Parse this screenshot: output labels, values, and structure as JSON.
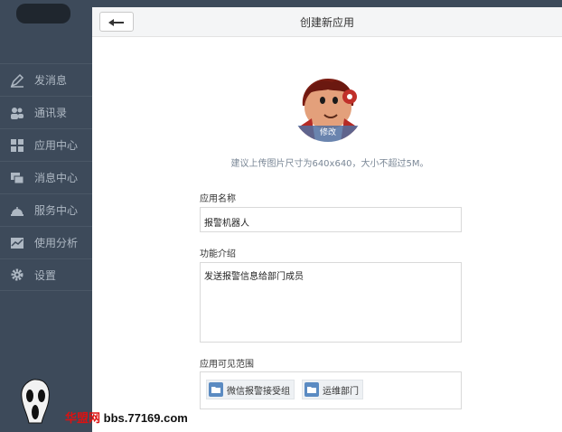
{
  "header": {
    "title": "创建新应用"
  },
  "sidebar": {
    "items": [
      {
        "label": "发消息",
        "icon": "pencil-icon"
      },
      {
        "label": "通讯录",
        "icon": "contacts-icon"
      },
      {
        "label": "应用中心",
        "icon": "apps-icon"
      },
      {
        "label": "消息中心",
        "icon": "messages-icon"
      },
      {
        "label": "服务中心",
        "icon": "service-bell-icon"
      },
      {
        "label": "使用分析",
        "icon": "analytics-icon"
      },
      {
        "label": "设置",
        "icon": "gear-icon"
      }
    ]
  },
  "avatar": {
    "edit_label": "修改"
  },
  "upload_hint": "建议上传图片尺寸为640x640，大小不超过5M。",
  "form": {
    "name_label": "应用名称",
    "name_value": "报警机器人",
    "intro_label": "功能介绍",
    "intro_value": "发送报警信息给部门成员",
    "scope_label": "应用可见范围",
    "scope_tags": [
      "微信报警接受组",
      "运维部门"
    ]
  },
  "watermark": {
    "cn": "华盟网",
    "url": "bbs.77169.com"
  },
  "colors": {
    "sidebar_bg": "#3d4a5a",
    "sidebar_text": "#aeb8c3",
    "tag_icon": "#5b8bc2",
    "hint_text": "#7a8796"
  }
}
